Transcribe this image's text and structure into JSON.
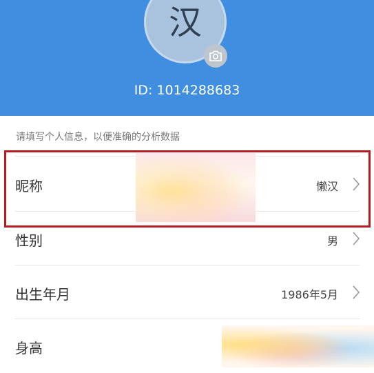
{
  "header": {
    "avatar_char": "汉",
    "id_text": "ID: 1014288683",
    "background_color": "#3f8ee0"
  },
  "hint": "请填写个人信息，以便准确的分析数据",
  "rows": [
    {
      "label": "昵称",
      "value": "懒汉"
    },
    {
      "label": "性别",
      "value": "男"
    },
    {
      "label": "出生年月",
      "value": "1986年5月"
    },
    {
      "label": "身高",
      "value": ""
    }
  ],
  "icons": {
    "camera": "camera-icon",
    "chevron": "chevron-right-icon"
  },
  "highlight_color": "#b31c22"
}
